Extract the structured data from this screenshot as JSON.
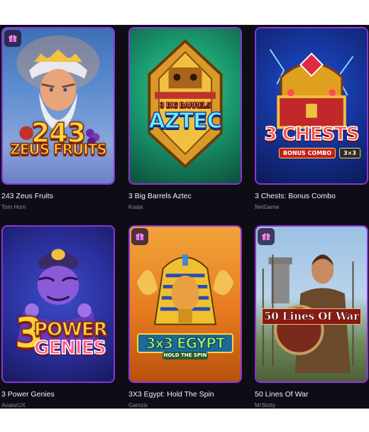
{
  "colors": {
    "page_bg": "#0e0d16",
    "card_border": "#8a35d6",
    "title_text": "#f4f4f6",
    "provider_text": "#8c8c98"
  },
  "games": [
    {
      "title": "243 Zeus Fruits",
      "provider": "Tom Horn",
      "has_gift_badge": true,
      "logo_lines": [
        "243",
        "ZEUS FRUITS"
      ]
    },
    {
      "title": "3 Big Barrels Aztec",
      "provider": "Koala",
      "has_gift_badge": false,
      "logo_lines": [
        "3 BIG BARRELS",
        "AZTEC"
      ]
    },
    {
      "title": "3 Chests: Bonus Combo",
      "provider": "NetGame",
      "has_gift_badge": false,
      "logo_lines": [
        "3 CHESTS",
        "BONUS COMBO",
        "3×3"
      ]
    },
    {
      "title": "3 Power Genies",
      "provider": "AvatarUX",
      "has_gift_badge": false,
      "logo_lines": [
        "3",
        "POWER",
        "GENIES"
      ]
    },
    {
      "title": "3X3 Egypt: Hold The Spin",
      "provider": "Gamzix",
      "has_gift_badge": true,
      "logo_lines": [
        "3x3 EGYPT",
        "HOLD THE SPIN"
      ]
    },
    {
      "title": "50 Lines Of War",
      "provider": "MrSlotty",
      "has_gift_badge": true,
      "logo_lines": [
        "50 Lines Of War"
      ]
    }
  ]
}
